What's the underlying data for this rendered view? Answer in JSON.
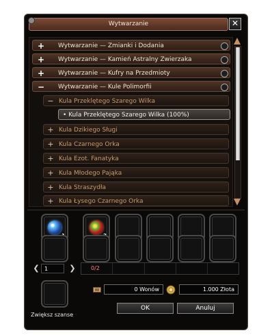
{
  "window": {
    "title": "Wytwarzanie",
    "close_symbol": "✕"
  },
  "categories_top": [
    {
      "sign": "+",
      "label": "Wytwarzanie — Zmianki i Dodania"
    },
    {
      "sign": "+",
      "label": "Wytwarzanie — Kamień Astralny Zwierzaka"
    },
    {
      "sign": "+",
      "label": "Wytwarzanie — Kufry na Przedmioty"
    },
    {
      "sign": "−",
      "label": "Wytwarzanie — Kule Polimorfii"
    }
  ],
  "expanded_sub": {
    "sign": "−",
    "label": "Kula Przeklętego Szarego Wilka"
  },
  "selected_recipe": {
    "bullet": "•",
    "label": "Kula Przeklętego Szarego Wilka (100%)"
  },
  "subcategories": [
    {
      "sign": "+",
      "label": "Kula Dzikiego Sługi"
    },
    {
      "sign": "+",
      "label": "Kula Czarnego Orka"
    },
    {
      "sign": "+",
      "label": "Kula Ezot. Fanatyka"
    },
    {
      "sign": "+",
      "label": "Kula Młodego Pająka"
    },
    {
      "sign": "+",
      "label": "Kula Straszydła"
    },
    {
      "sign": "+",
      "label": "Kula Łysego Czarnego Orka"
    }
  ],
  "result_slot": {
    "item": "blue-orb",
    "count": "1"
  },
  "material_slots": [
    {
      "item": "red-orb",
      "count": "2"
    }
  ],
  "page": {
    "value": "1",
    "prev": "❮",
    "next": "❯"
  },
  "materials_ratio": "0/2",
  "money": {
    "won": "0 Wonów",
    "gold": "1.000 Złota"
  },
  "buttons": {
    "ok": "OK",
    "cancel": "Anuluj"
  },
  "chance_label": "Zwiększ szanse",
  "colors": {
    "accent_title": "#5e3526",
    "ratio_text": "#ff8080"
  }
}
